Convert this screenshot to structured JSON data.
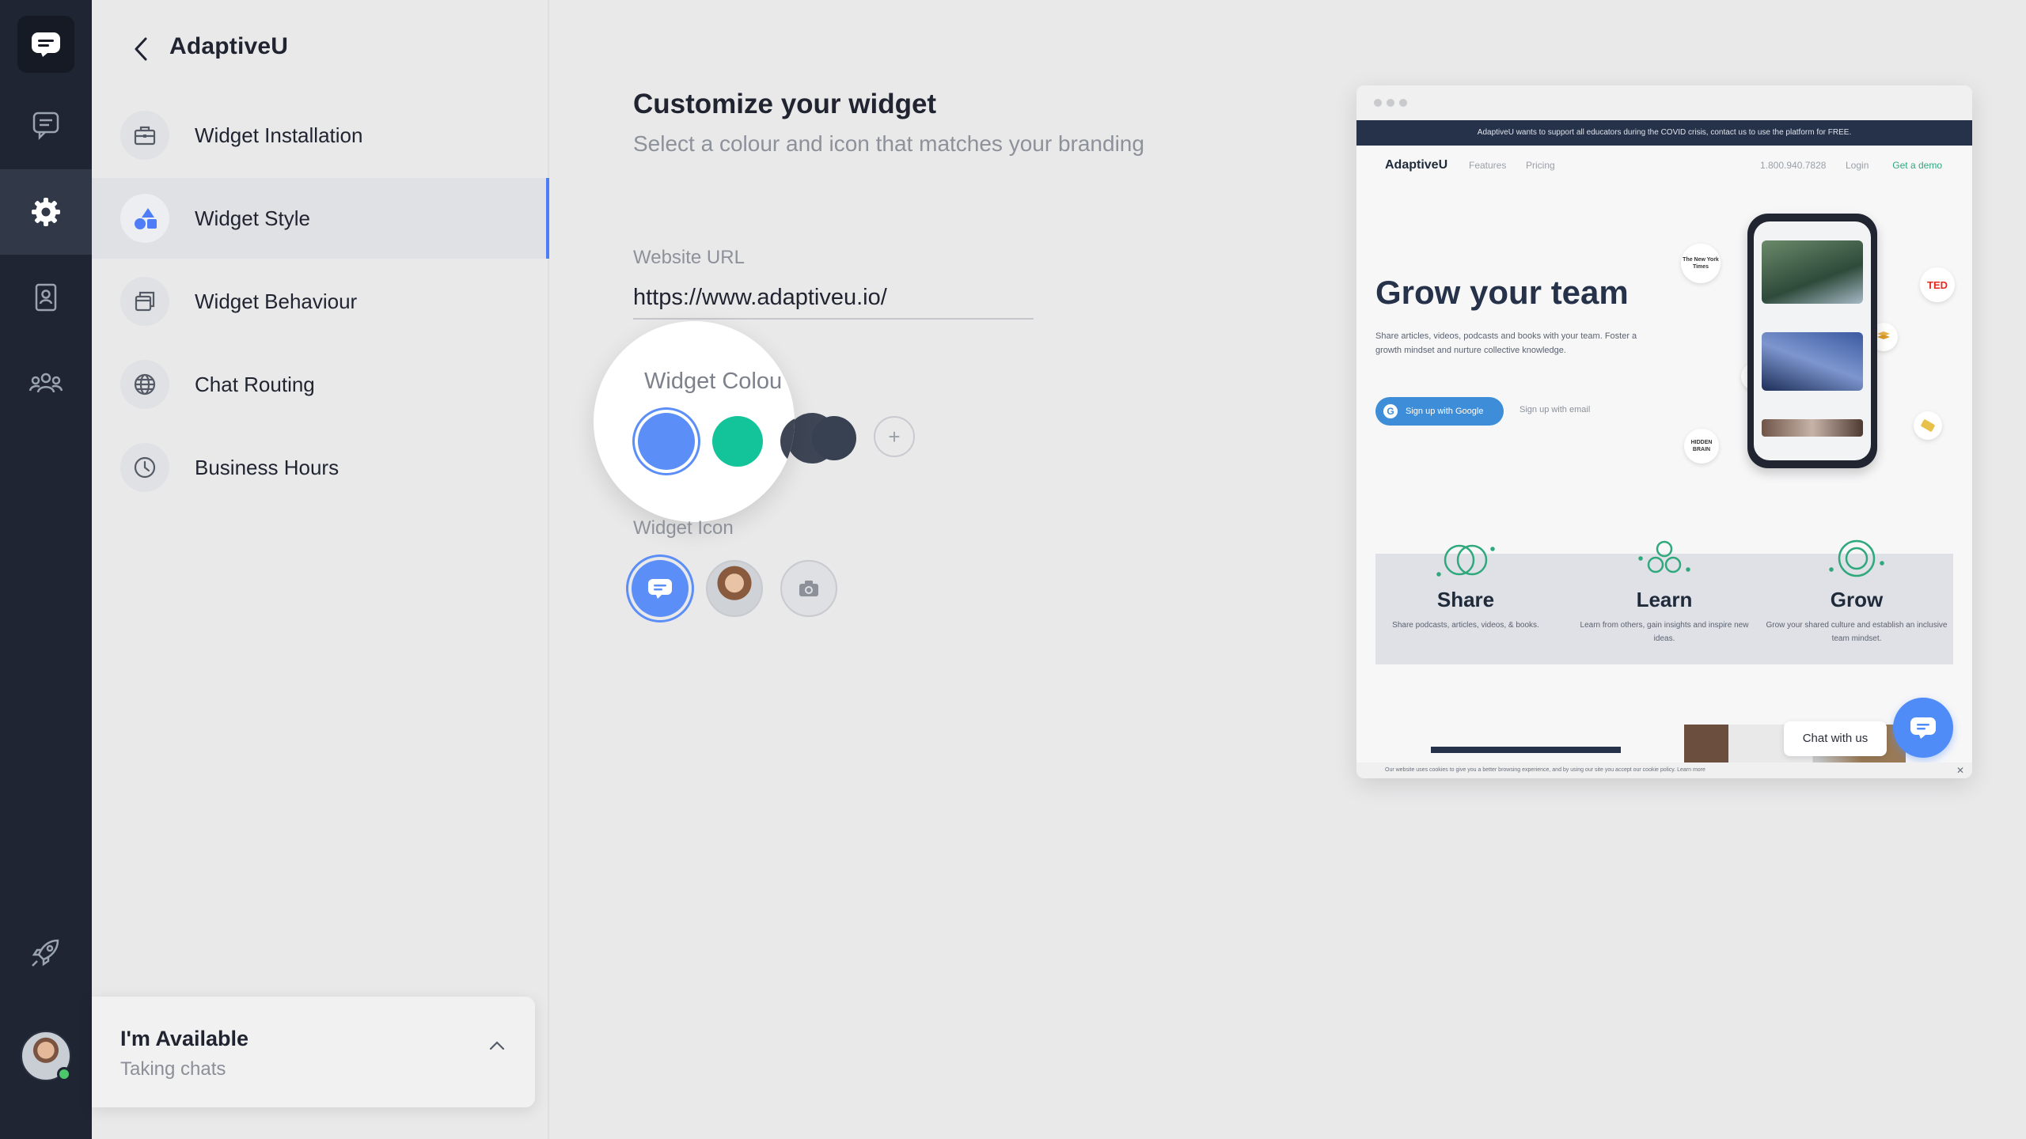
{
  "rail": {
    "icons": [
      "chat-logo-icon",
      "conversations-icon",
      "settings-icon",
      "contacts-icon",
      "team-icon",
      "launch-icon"
    ]
  },
  "sidebar": {
    "title": "AdaptiveU",
    "items": [
      {
        "label": "Widget Installation",
        "icon": "briefcase-icon"
      },
      {
        "label": "Widget Style",
        "icon": "shapes-icon",
        "active": true
      },
      {
        "label": "Widget Behaviour",
        "icon": "windows-icon"
      },
      {
        "label": "Chat Routing",
        "icon": "globe-icon"
      },
      {
        "label": "Business Hours",
        "icon": "clock-icon"
      }
    ],
    "status": {
      "title": "I'm Available",
      "subtitle": "Taking chats"
    }
  },
  "main": {
    "title": "Customize your widget",
    "subtitle": "Select a colour and icon that matches your branding",
    "url_label": "Website URL",
    "url_value": "https://www.adaptiveu.io/",
    "colour_label": "Widget Colou",
    "colours": [
      "#5b8ef7",
      "#13c49a",
      "#3e4656",
      "#374151"
    ],
    "add_colour": "+",
    "icon_label": "Widget Icon",
    "icons": [
      "chat-bubble-icon",
      "agent-photo",
      "camera-icon"
    ]
  },
  "preview": {
    "banner": "AdaptiveU wants to support all educators during the COVID crisis, contact us to use the platform for FREE.",
    "brand": "AdaptiveU",
    "nav": [
      "Features",
      "Pricing"
    ],
    "phone_number": "1.800.940.7828",
    "login": "Login",
    "demo": "Get a demo",
    "hero_title": "Grow your team",
    "hero_text": "Share articles, videos, podcasts and books with your team. Foster a growth mindset and nurture collective knowledge.",
    "google_btn": "Sign up with Google",
    "email_btn": "Sign up with email",
    "badges": [
      "The New York Times",
      "TED",
      "HIDDEN BRAIN"
    ],
    "features": [
      {
        "title": "Share",
        "text": "Share podcasts, articles, videos, & books."
      },
      {
        "title": "Learn",
        "text": "Learn from others, gain insights and inspire new ideas."
      },
      {
        "title": "Grow",
        "text": "Grow your shared culture and establish an inclusive team mindset."
      }
    ],
    "chat_tip": "Chat with us",
    "cookie": "Our website uses cookies to give you a better browsing experience, and by using our site you accept our cookie policy. Learn more",
    "close": "✕"
  }
}
